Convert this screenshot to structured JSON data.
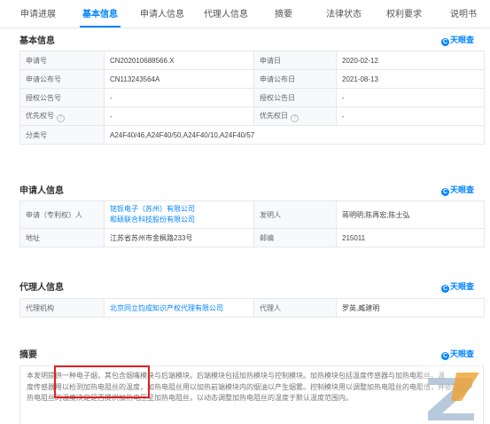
{
  "tabs": [
    "申请进展",
    "基本信息",
    "申请人信息",
    "代理人信息",
    "摘要",
    "法律状态",
    "权利要求",
    "说明书"
  ],
  "brand": "天眼查",
  "basic": {
    "title": "基本信息",
    "rows": [
      {
        "l1": "申请号",
        "v1": "CN202010688566.X",
        "l2": "申请日",
        "v2": "2020-02-12"
      },
      {
        "l1": "申请公布号",
        "v1": "CN113243564A",
        "l2": "申请公布日",
        "v2": "2021-08-13"
      },
      {
        "l1": "授权公告号",
        "v1": "-",
        "l2": "授权公告日",
        "v2": "-"
      },
      {
        "l1": "优先权号",
        "v1": "-",
        "l2": "优先权日",
        "v2": "-"
      }
    ],
    "class_label": "分类号",
    "class_value": "A24F40/46,A24F40/50,A24F40/10,A24F40/57"
  },
  "applicant": {
    "title": "申请人信息",
    "applicant_label": "申请（专利权）人",
    "applicant_1": "铭铄电子（苏州）有限公司",
    "applicant_2": "和硕联合科技股份有限公司",
    "inventor_label": "发明人",
    "inventor_value": "蒋明明;陈再宏;陈士弘",
    "address_label": "地址",
    "address_value": "江苏省苏州市金枫路233号",
    "zip_label": "邮编",
    "zip_value": "215011"
  },
  "agent": {
    "title": "代理人信息",
    "agency_label": "代理机构",
    "agency_value": "北京同立钧成知识产权代理有限公司",
    "agent_label": "代理人",
    "agent_value": "罗英,臧建明"
  },
  "abstract": {
    "title": "摘要",
    "line1": "本发明提供一种电子烟，其包含烟嘴模块与后端模块。后端模块包括加热模块与控制模块。加热模块包括温度传感器与加热电阻丝。温",
    "line2": "度传感器用以检测加热电阻丝的温度，加热电阻丝用以加热前端模块内的烟油以产生烟雾。控制模块用以调整加热电阻丝的电阻值，并依照加",
    "line3": "热电阻丝的温度决定是否提供加热电压至加热电阻丝，以动态调整加热电阻丝的温度于默认温度范围内。"
  }
}
